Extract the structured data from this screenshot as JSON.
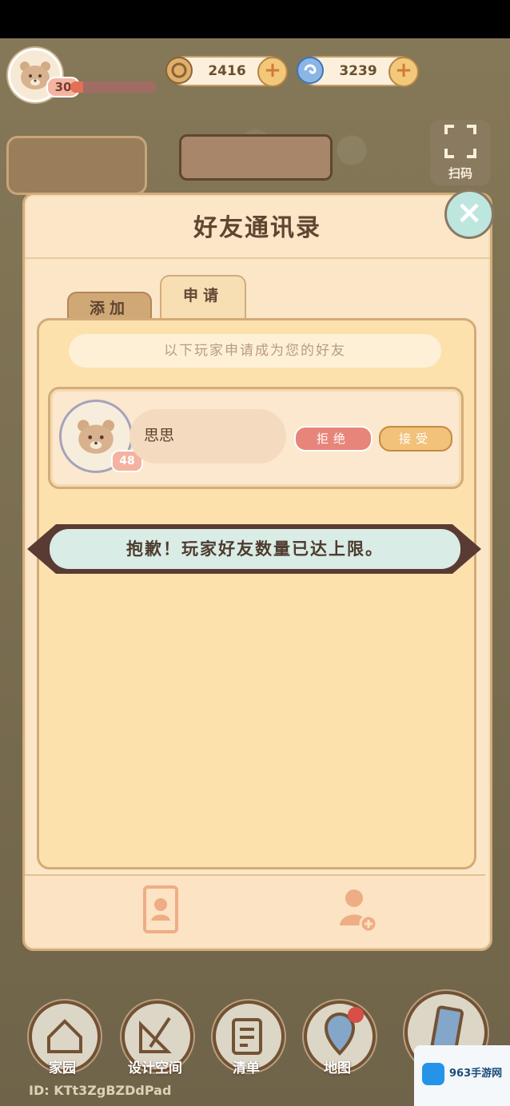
{
  "hud": {
    "player_level": "30",
    "xp_progress": 0.15,
    "currency_a": "2416",
    "currency_b": "3239",
    "plus": "+"
  },
  "dialog": {
    "title": "好友通讯录",
    "tabs": [
      "添加",
      "申请"
    ],
    "active_tab": "申请",
    "notice": "以下玩家申请成为您的好友",
    "request": {
      "name": "思思",
      "level": "48",
      "reject_label": "拒绝",
      "accept_label": "接受"
    },
    "toast": "抱歉！玩家好友数量已达上限。"
  },
  "bottom_nav": [
    "家园",
    "设计空间",
    "清单",
    "地图"
  ],
  "scan_label": "扫码",
  "player_id": "ID: KTt3ZgBZDdPad",
  "watermark": "963手游网",
  "colors": {
    "accent": "#d2ab78",
    "panel": "#fde1ad",
    "reject": "#e8857a",
    "accept": "#f2c17a",
    "toast": "#d9ece5"
  }
}
